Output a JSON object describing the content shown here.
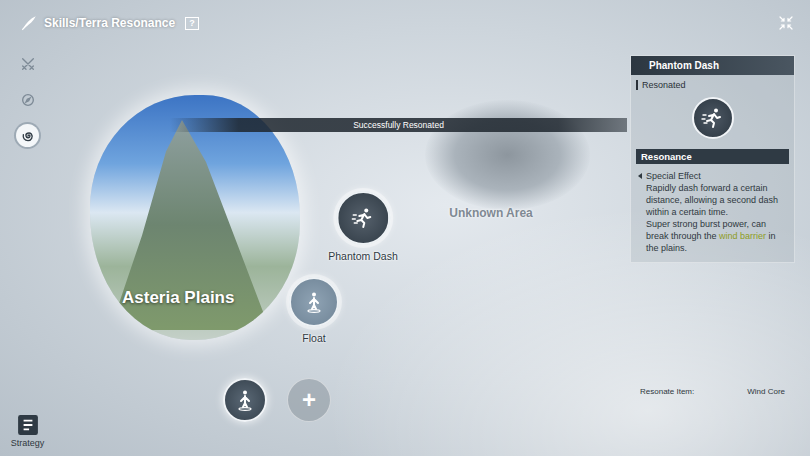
{
  "header": {
    "title": "Skills/Terra Resonance",
    "help": "?"
  },
  "sidebar": {
    "items": [
      {
        "kind": "swords",
        "selected": false
      },
      {
        "kind": "compass",
        "selected": false
      },
      {
        "kind": "spiral",
        "selected": true
      }
    ],
    "strategy": {
      "label": "Strategy"
    }
  },
  "banner": "Successfully Resonated",
  "regions": [
    {
      "name": "Asteria Plains",
      "discovered": true
    },
    {
      "name": "Unknown Area",
      "discovered": false
    }
  ],
  "skills": [
    {
      "name": "Phantom Dash",
      "kind": "dash",
      "selected": true
    },
    {
      "name": "Float",
      "kind": "float",
      "selected": false
    }
  ],
  "slots": [
    {
      "kind": "float",
      "selected": true
    },
    {
      "kind": "add",
      "symbol": "+",
      "selected": false
    }
  ],
  "panel": {
    "title": "Phantom Dash",
    "kind": "dash",
    "status": "Resonated",
    "section": "Resonance",
    "effect_title": "Special Effect",
    "effect_text": "Rapidly dash forward a certain distance, allowing a second dash within a certain time.",
    "burst": [
      {
        "text": "Super strong burst power, can break through the ",
        "highlight": false
      },
      {
        "text": "wind barrier",
        "highlight": true
      },
      {
        "text": " in the plains.",
        "highlight": false
      }
    ],
    "resonate_item": {
      "label": "Resonate Item:",
      "value": "Wind Core"
    }
  }
}
